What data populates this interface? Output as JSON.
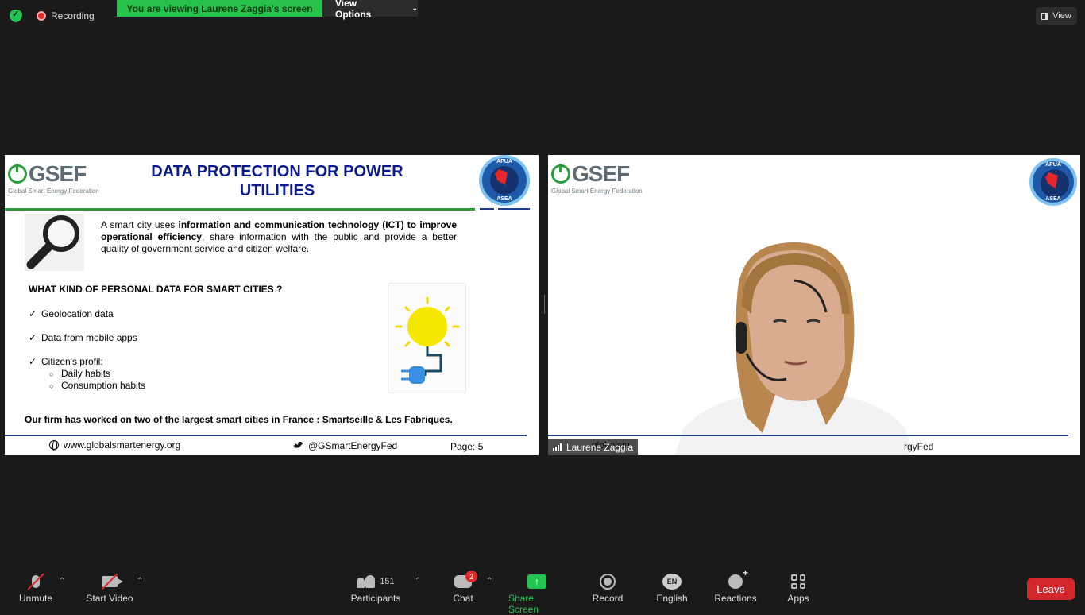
{
  "top_bar": {
    "recording_label": "Recording",
    "viewing_banner": "You are viewing Laurene Zaggia's screen",
    "view_options_label": "View Options",
    "view_button_label": "View"
  },
  "slide": {
    "org_name": "GSEF",
    "org_tagline": "Global Smart Energy Federation",
    "partner_logo_top": "APUA",
    "partner_logo_bottom": "ASEA",
    "title": "DATA PROTECTION FOR POWER UTILITIES",
    "intro_parts": {
      "p1": "A smart city uses ",
      "b1": "information and communication technology (ICT) to improve operational efficiency",
      "p2": ", share information with the public and provide a better quality of government service and citizen welfare."
    },
    "question": "WHAT KIND OF PERSONAL DATA FOR SMART CITIES ?",
    "bullets": [
      "Geolocation data",
      "Data from mobile apps",
      "Citizen's profil:"
    ],
    "sub_bullets": [
      "Daily habits",
      "Consumption habits"
    ],
    "closing": "Our firm has worked on two of the largest smart cities in France : Smartseille & Les Fabriques.",
    "website": "www.globalsmartenergy.org",
    "twitter": "@GSmartEnergyFed",
    "page_label": "Page: 5"
  },
  "video": {
    "participant_name": "Laurene Zaggia",
    "bg_text_left": "globalsm",
    "bg_text_right": "rgyFed"
  },
  "toolbar": {
    "unmute": "Unmute",
    "start_video": "Start Video",
    "participants": "Participants",
    "participant_count": "151",
    "chat": "Chat",
    "chat_badge": "2",
    "share_screen": "Share Screen",
    "record": "Record",
    "language": "English",
    "language_code": "EN",
    "reactions": "Reactions",
    "apps": "Apps",
    "leave": "Leave"
  }
}
